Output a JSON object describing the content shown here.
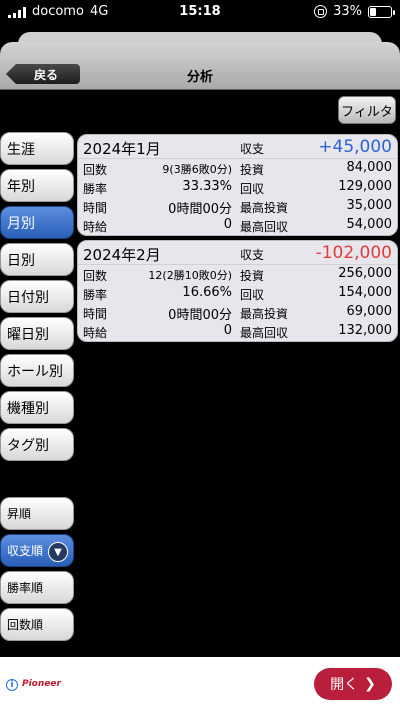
{
  "status": {
    "carrier": "docomo",
    "network": "4G",
    "time": "15:18",
    "battery": "33%",
    "battery_fill": 0.33
  },
  "nav": {
    "back": "戻る",
    "title": "分析"
  },
  "toolbar": {
    "filter": "フィルタ"
  },
  "menu": {
    "categories": [
      "生涯",
      "年別",
      "月別",
      "日別",
      "日付別",
      "曜日別",
      "ホール別",
      "機種別",
      "タグ別"
    ],
    "sorts": [
      "昇順",
      "収支順",
      "勝率順",
      "回数順"
    ]
  },
  "cards": [
    {
      "month": "2024年1月",
      "profit_label": "収支",
      "profit": "+45,000",
      "count_label": "回数",
      "count": "9(3勝6敗0分)",
      "invest_label": "投資",
      "invest": "84,000",
      "winrate_label": "勝率",
      "winrate": "33.33%",
      "recover_label": "回収",
      "recover": "129,000",
      "time_label": "時間",
      "time": "0時間00分",
      "max_invest_label": "最高投資",
      "max_invest": "35,000",
      "hourly_label": "時給",
      "hourly": "0",
      "max_recover_label": "最高回収",
      "max_recover": "54,000"
    },
    {
      "month": "2024年2月",
      "profit_label": "収支",
      "profit": "-102,000",
      "count_label": "回数",
      "count": "12(2勝10敗0分)",
      "invest_label": "投資",
      "invest": "256,000",
      "winrate_label": "勝率",
      "winrate": "16.66%",
      "recover_label": "回収",
      "recover": "154,000",
      "time_label": "時間",
      "time": "0時間00分",
      "max_invest_label": "最高投資",
      "max_invest": "69,000",
      "hourly_label": "時給",
      "hourly": "0",
      "max_recover_label": "最高回収",
      "max_recover": "132,000"
    }
  ],
  "ad": {
    "brand": "Pioneer",
    "open": "開く",
    "open_icon": "chevron-right-icon"
  },
  "colors": {
    "positive": "#2d63d8",
    "negative": "#e23b3b",
    "active": "#2a5fb8"
  }
}
